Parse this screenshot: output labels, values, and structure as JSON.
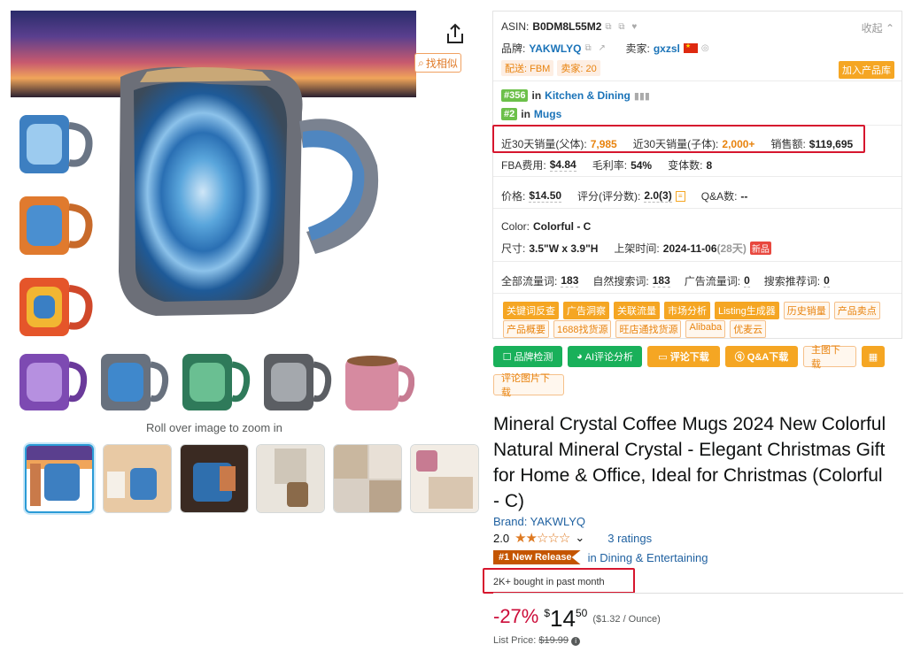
{
  "gallery": {
    "find_similar_label": "找相似",
    "zoom_hint": "Roll over image to zoom in"
  },
  "panel": {
    "collapse_label": "收起",
    "asin_label": "ASIN:",
    "asin": "B0DM8L55M2",
    "brand_label": "品牌:",
    "brand": "YAKWLYQ",
    "seller_label": "卖家:",
    "seller": "gxzsl",
    "delivery": "配送: FBM",
    "seller_count": "卖家: 20",
    "add_to_library": "加入产品库",
    "rank1": "#356",
    "rank1_in": "in",
    "rank1_cat": "Kitchen & Dining",
    "rank2": "#2",
    "rank2_in": "in",
    "rank2_cat": "Mugs",
    "sales_parent_label": "近30天销量(父体):",
    "sales_parent": "7,985",
    "sales_child_label": "近30天销量(子体):",
    "sales_child": "2,000+",
    "revenue_label": "销售额:",
    "revenue": "$119,695",
    "fba_label": "FBA费用:",
    "fba": "$4.84",
    "margin_label": "毛利率:",
    "margin": "54%",
    "variants_label": "变体数:",
    "variants": "8",
    "price_label": "价格:",
    "price": "$14.50",
    "rating_label": "评分(评分数):",
    "rating": "2.0(3)",
    "qa_label": "Q&A数:",
    "qa": "--",
    "color_label": "Color:",
    "color": "Colorful - C",
    "size_label": "尺寸:",
    "size": "3.5\"W x 3.9\"H",
    "listed_label": "上架时间:",
    "listed": "2024-11-06",
    "listed_days": "(28天)",
    "new_tag": "新品",
    "total_kw_label": "全部流量词:",
    "total_kw": "183",
    "organic_kw_label": "自然搜索词:",
    "organic_kw": "183",
    "ad_kw_label": "广告流量词:",
    "ad_kw": "0",
    "rec_kw_label": "搜索推荐词:",
    "rec_kw": "0",
    "tags_row1": [
      "关键词反查",
      "广告洞察",
      "关联流量",
      "市场分析",
      "Listing生成器",
      "历史销量",
      "产品卖点"
    ],
    "tags_row2": [
      "产品概要",
      "1688找货源",
      "旺店通找货源",
      "Alibaba",
      "优麦云"
    ]
  },
  "buttons": {
    "brand_check": "品牌检测",
    "ai_review": "AI评论分析",
    "review_download": "评论下载",
    "qa_download": "Q&A下载",
    "main_img_download": "主图下载",
    "review_img_download": "评论图片下载"
  },
  "product": {
    "title": "Mineral Crystal Coffee Mugs 2024 New Colorful Natural Mineral Crystal - Elegant Christmas Gift for Home & Office, Ideal for Christmas (Colorful - C)",
    "brand": "Brand: YAKWLYQ",
    "rating_value": "2.0",
    "stars": "★★☆☆☆",
    "rating_count": "3 ratings",
    "new_release_badge": "#1 New Release",
    "new_release_cat": "in Dining & Entertaining",
    "bought": "2K+ bought in past month",
    "discount": "-27%",
    "currency": "$",
    "price_whole": "14",
    "price_cents": "50",
    "unit_price": "($1.32 / Ounce)",
    "list_price_label": "List Price:",
    "list_price": "$19.99"
  },
  "colors": {
    "accent_orange": "#f5a623",
    "green": "#19b05a",
    "highlight_red": "#d6162e",
    "link_blue": "#2162a1"
  }
}
